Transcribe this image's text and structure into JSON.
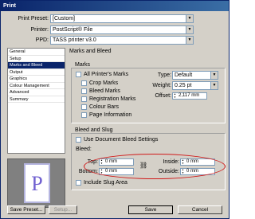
{
  "window": {
    "title": "Print"
  },
  "header": {
    "preset": {
      "label": "Print Preset:",
      "value": "[Custom]"
    },
    "printer": {
      "label": "Printer:",
      "value": "PostScript® File"
    },
    "ppd": {
      "label": "PPD:",
      "value": "TASS printer v3.0"
    }
  },
  "sidebar": {
    "items": [
      {
        "label": "General"
      },
      {
        "label": "Setup"
      },
      {
        "label": "Marks and Bleed",
        "active": true
      },
      {
        "label": "Output"
      },
      {
        "label": "Graphics"
      },
      {
        "label": "Colour Management"
      },
      {
        "label": "Advanced"
      },
      {
        "label": "Summary"
      }
    ]
  },
  "preview": {
    "letter": "P"
  },
  "panel_title": "Marks and Bleed",
  "marks": {
    "title": "Marks",
    "all_printers_marks": "All Printer's Marks",
    "crop_marks": "Crop Marks",
    "bleed_marks": "Bleed Marks",
    "registration_marks": "Registration Marks",
    "colour_bars": "Colour Bars",
    "page_information": "Page Information",
    "type": {
      "label": "Type:",
      "value": "Default"
    },
    "weight": {
      "label": "Weight:",
      "value": "0.25 pt"
    },
    "offset": {
      "label": "Offset:",
      "value": "2,117 mm"
    }
  },
  "bleed": {
    "title": "Bleed and Slug",
    "use_document": "Use Document Bleed Settings",
    "bleed_label": "Bleed:",
    "top": {
      "label": "Top:",
      "value": "0 mm"
    },
    "bottom": {
      "label": "Bottom:",
      "value": "0 mm"
    },
    "inside": {
      "label": "Inside:",
      "value": "0 mm"
    },
    "outside": {
      "label": "Outside:",
      "value": "0 mm"
    },
    "include_slug": "Include Slug Area"
  },
  "footer": {
    "save_preset": "Save Preset...",
    "setup": "Setup...",
    "save": "Save",
    "cancel": "Cancel"
  },
  "colors": {
    "title_bar": "#0a246a",
    "selection": "#0a246a",
    "annotation": "#d01818"
  }
}
